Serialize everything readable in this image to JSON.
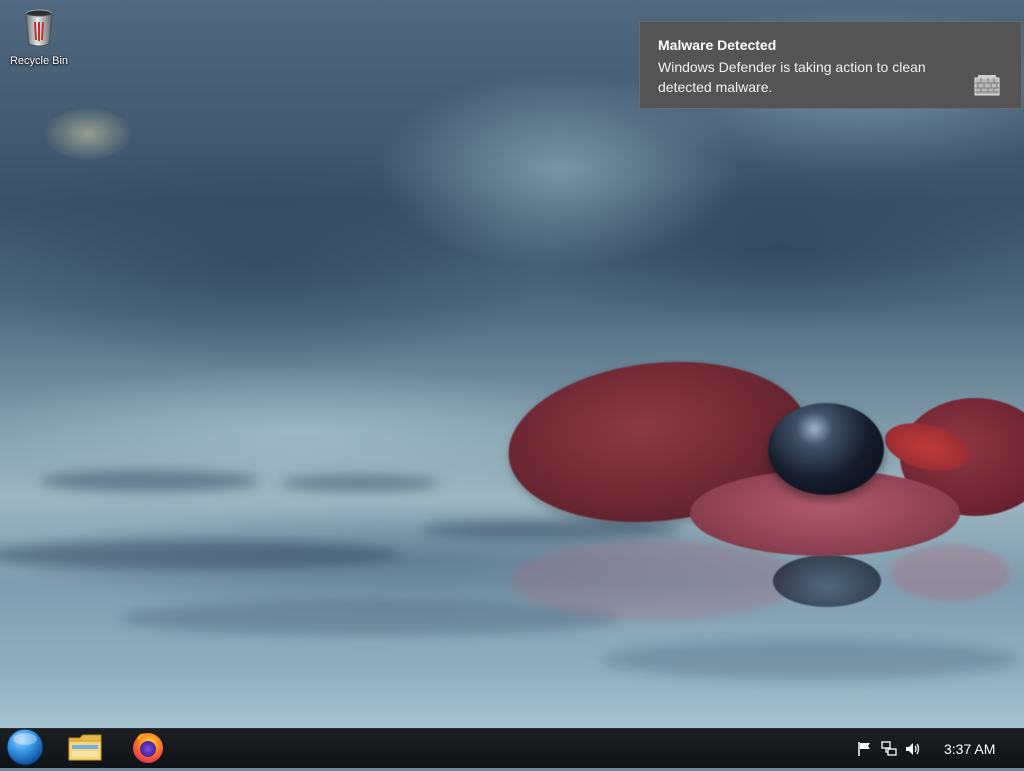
{
  "desktop": {
    "icons": [
      {
        "label": "Recycle Bin",
        "icon": "recycle-bin-icon"
      }
    ]
  },
  "notification": {
    "title": "Malware Detected",
    "body": "Windows Defender is taking action to clean detected malware.",
    "icon": "defender-shield-icon"
  },
  "taskbar": {
    "start_icon": "start-orb-icon",
    "pinned": [
      {
        "name": "File Explorer",
        "icon": "folder-icon"
      },
      {
        "name": "Firefox",
        "icon": "firefox-icon"
      }
    ],
    "tray": {
      "icons": [
        "action-center-flag-icon",
        "network-icon",
        "volume-icon"
      ],
      "clock": "3:37 AM"
    }
  },
  "colors": {
    "taskbar": "#111416",
    "notification_bg": "#545454",
    "start_orb": "#3d9be8"
  }
}
